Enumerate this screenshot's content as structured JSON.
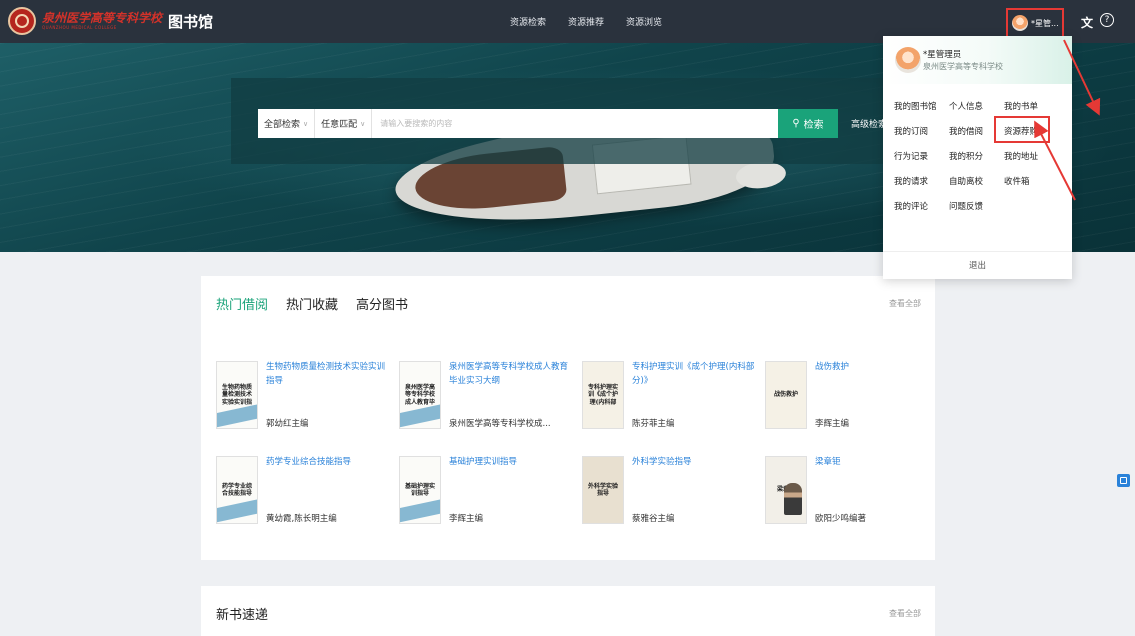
{
  "header": {
    "school_logo_text": "泉州医学高等专科学校",
    "school_logo_en": "QUANZHOU MEDICAL COLLEGE",
    "library_title": "图书馆",
    "nav": [
      "资源检索",
      "资源推荐",
      "资源浏览"
    ],
    "user_name": "*星管...",
    "translate_icon": "文",
    "help_icon": "?"
  },
  "search": {
    "scope": "全部检索",
    "match": "任意匹配",
    "placeholder": "请输入要搜索的内容",
    "button": "检索",
    "advanced": "高级检索"
  },
  "hot": {
    "tabs": [
      "热门借阅",
      "热门收藏",
      "高分图书"
    ],
    "view_all": "查看全部",
    "books": [
      {
        "title": "生物药物质量检测技术实验实训指导",
        "author": "郭幼红主编",
        "cover_text": "生物药物质\n量检测技术\n实验实训指"
      },
      {
        "title": "泉州医学高等专科学校成人教育毕业实习大纲",
        "author": "泉州医学高等专科学校成...",
        "cover_text": "泉州医学高\n等专科学校\n成人教育毕"
      },
      {
        "title": "专科护理实训《成个护理(内科部分)》",
        "author": "陈芬菲主编",
        "cover_text": "专科护理实\n训《成个护\n理(内科部"
      },
      {
        "title": "战伤救护",
        "author": "李辉主编",
        "cover_text": "战伤救护"
      },
      {
        "title": "药学专业综合技能指导",
        "author": "黄幼霞,陈长明主编",
        "cover_text": "药学专业综\n合技能指导"
      },
      {
        "title": "基础护理实训指导",
        "author": "李辉主编",
        "cover_text": "基础护理实\n训指导"
      },
      {
        "title": "外科学实验指导",
        "author": "蔡雅谷主编",
        "cover_text": "外科学实验\n指导"
      },
      {
        "title": "梁章钜",
        "author": "欧阳少鸣编著",
        "cover_text": "梁章钜"
      }
    ]
  },
  "new_books": {
    "title": "新书速递",
    "view_all": "查看全部"
  },
  "user_menu": {
    "name": "*星管理员",
    "school": "泉州医学高等专科学校",
    "items": [
      "我的图书馆",
      "个人信息",
      "我的书单",
      "我的订阅",
      "我的借阅",
      "资源荐购",
      "行为记录",
      "我的积分",
      "我的地址",
      "我的请求",
      "自助离校",
      "收件箱",
      "我的评论",
      "问题反馈"
    ],
    "logout": "退出"
  },
  "colors": {
    "accent": "#1aa37a",
    "link": "#2a82d9",
    "topbar": "#2a323d",
    "annotation": "#e53935"
  }
}
